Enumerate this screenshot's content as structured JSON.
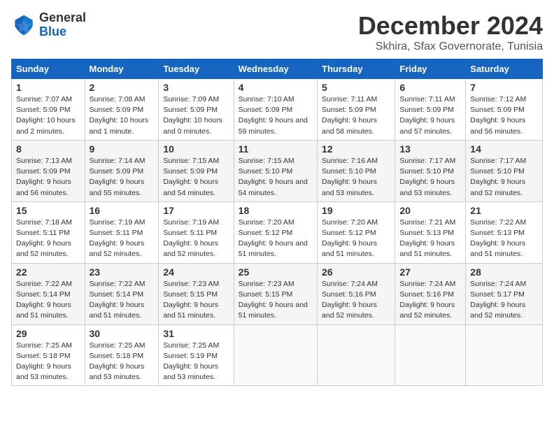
{
  "header": {
    "logo_line1": "General",
    "logo_line2": "Blue",
    "month_title": "December 2024",
    "location": "Skhira, Sfax Governorate, Tunisia"
  },
  "columns": [
    "Sunday",
    "Monday",
    "Tuesday",
    "Wednesday",
    "Thursday",
    "Friday",
    "Saturday"
  ],
  "weeks": [
    [
      {
        "day": "1",
        "sunrise": "7:07 AM",
        "sunset": "5:09 PM",
        "daylight": "10 hours and 2 minutes."
      },
      {
        "day": "2",
        "sunrise": "7:08 AM",
        "sunset": "5:09 PM",
        "daylight": "10 hours and 1 minute."
      },
      {
        "day": "3",
        "sunrise": "7:09 AM",
        "sunset": "5:09 PM",
        "daylight": "10 hours and 0 minutes."
      },
      {
        "day": "4",
        "sunrise": "7:10 AM",
        "sunset": "5:09 PM",
        "daylight": "9 hours and 59 minutes."
      },
      {
        "day": "5",
        "sunrise": "7:11 AM",
        "sunset": "5:09 PM",
        "daylight": "9 hours and 58 minutes."
      },
      {
        "day": "6",
        "sunrise": "7:11 AM",
        "sunset": "5:09 PM",
        "daylight": "9 hours and 57 minutes."
      },
      {
        "day": "7",
        "sunrise": "7:12 AM",
        "sunset": "5:09 PM",
        "daylight": "9 hours and 56 minutes."
      }
    ],
    [
      {
        "day": "8",
        "sunrise": "7:13 AM",
        "sunset": "5:09 PM",
        "daylight": "9 hours and 56 minutes."
      },
      {
        "day": "9",
        "sunrise": "7:14 AM",
        "sunset": "5:09 PM",
        "daylight": "9 hours and 55 minutes."
      },
      {
        "day": "10",
        "sunrise": "7:15 AM",
        "sunset": "5:09 PM",
        "daylight": "9 hours and 54 minutes."
      },
      {
        "day": "11",
        "sunrise": "7:15 AM",
        "sunset": "5:10 PM",
        "daylight": "9 hours and 54 minutes."
      },
      {
        "day": "12",
        "sunrise": "7:16 AM",
        "sunset": "5:10 PM",
        "daylight": "9 hours and 53 minutes."
      },
      {
        "day": "13",
        "sunrise": "7:17 AM",
        "sunset": "5:10 PM",
        "daylight": "9 hours and 53 minutes."
      },
      {
        "day": "14",
        "sunrise": "7:17 AM",
        "sunset": "5:10 PM",
        "daylight": "9 hours and 52 minutes."
      }
    ],
    [
      {
        "day": "15",
        "sunrise": "7:18 AM",
        "sunset": "5:11 PM",
        "daylight": "9 hours and 52 minutes."
      },
      {
        "day": "16",
        "sunrise": "7:19 AM",
        "sunset": "5:11 PM",
        "daylight": "9 hours and 52 minutes."
      },
      {
        "day": "17",
        "sunrise": "7:19 AM",
        "sunset": "5:11 PM",
        "daylight": "9 hours and 52 minutes."
      },
      {
        "day": "18",
        "sunrise": "7:20 AM",
        "sunset": "5:12 PM",
        "daylight": "9 hours and 51 minutes."
      },
      {
        "day": "19",
        "sunrise": "7:20 AM",
        "sunset": "5:12 PM",
        "daylight": "9 hours and 51 minutes."
      },
      {
        "day": "20",
        "sunrise": "7:21 AM",
        "sunset": "5:13 PM",
        "daylight": "9 hours and 51 minutes."
      },
      {
        "day": "21",
        "sunrise": "7:22 AM",
        "sunset": "5:13 PM",
        "daylight": "9 hours and 51 minutes."
      }
    ],
    [
      {
        "day": "22",
        "sunrise": "7:22 AM",
        "sunset": "5:14 PM",
        "daylight": "9 hours and 51 minutes."
      },
      {
        "day": "23",
        "sunrise": "7:22 AM",
        "sunset": "5:14 PM",
        "daylight": "9 hours and 51 minutes."
      },
      {
        "day": "24",
        "sunrise": "7:23 AM",
        "sunset": "5:15 PM",
        "daylight": "9 hours and 51 minutes."
      },
      {
        "day": "25",
        "sunrise": "7:23 AM",
        "sunset": "5:15 PM",
        "daylight": "9 hours and 51 minutes."
      },
      {
        "day": "26",
        "sunrise": "7:24 AM",
        "sunset": "5:16 PM",
        "daylight": "9 hours and 52 minutes."
      },
      {
        "day": "27",
        "sunrise": "7:24 AM",
        "sunset": "5:16 PM",
        "daylight": "9 hours and 52 minutes."
      },
      {
        "day": "28",
        "sunrise": "7:24 AM",
        "sunset": "5:17 PM",
        "daylight": "9 hours and 52 minutes."
      }
    ],
    [
      {
        "day": "29",
        "sunrise": "7:25 AM",
        "sunset": "5:18 PM",
        "daylight": "9 hours and 53 minutes."
      },
      {
        "day": "30",
        "sunrise": "7:25 AM",
        "sunset": "5:18 PM",
        "daylight": "9 hours and 53 minutes."
      },
      {
        "day": "31",
        "sunrise": "7:25 AM",
        "sunset": "5:19 PM",
        "daylight": "9 hours and 53 minutes."
      },
      null,
      null,
      null,
      null
    ]
  ]
}
